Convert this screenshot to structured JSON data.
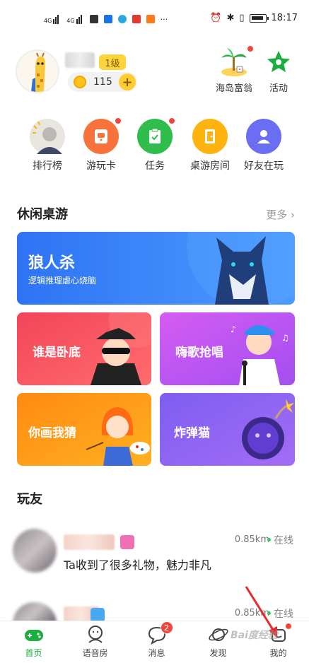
{
  "status_bar": {
    "time": "18:17",
    "net1": "4G",
    "net2": "4G"
  },
  "profile": {
    "level": "1级",
    "coins": "115",
    "coin_add": "+"
  },
  "top_actions": [
    {
      "label": "海岛富翁",
      "icon": "island-icon"
    },
    {
      "label": "活动",
      "icon": "star-icon"
    }
  ],
  "entries": [
    {
      "label": "排行榜",
      "icon": "ranking-avatar-icon"
    },
    {
      "label": "游玩卡",
      "icon": "play-card-icon",
      "color": "#f7733b"
    },
    {
      "label": "任务",
      "icon": "task-icon",
      "color": "#2fbd4c"
    },
    {
      "label": "桌游房间",
      "icon": "door-icon",
      "color": "#ffb30f"
    },
    {
      "label": "好友在玩",
      "icon": "friend-icon",
      "color": "#6b6ef2"
    }
  ],
  "casual_section": {
    "title": "休闲桌游",
    "more": "更多"
  },
  "games": {
    "werewolf": {
      "title": "狼人杀",
      "subtitle": "逻辑推理虐心烧脑"
    },
    "undercover": {
      "title": "谁是卧底"
    },
    "sing": {
      "title": "嗨歌抢唱"
    },
    "draw_guess": {
      "title": "你画我猜"
    },
    "bomb_cat": {
      "title": "炸弹猫"
    }
  },
  "friends_section": {
    "title": "玩友"
  },
  "friends": [
    {
      "distance": "0.85km",
      "status": "在线",
      "message": "Ta收到了很多礼物，魅力非凡"
    },
    {
      "distance": "0.85km",
      "status": "在线",
      "message": ""
    }
  ],
  "bottom_nav": [
    {
      "label": "首页",
      "icon": "gamepad-icon",
      "active": true
    },
    {
      "label": "语音房",
      "icon": "voice-room-icon"
    },
    {
      "label": "消息",
      "icon": "message-icon",
      "badge": "2"
    },
    {
      "label": "发现",
      "icon": "planet-icon"
    },
    {
      "label": "我的",
      "icon": "mine-icon"
    }
  ],
  "watermark": "Bai度经验",
  "colors": {
    "accent_green": "#1aad3f",
    "werewolf_blue": "#2e73f5",
    "undercover_red": "#f2455a",
    "sing_purple": "#c55cf0",
    "draw_orange": "#ff8a12",
    "bomb_violet": "#7d5ef0"
  }
}
